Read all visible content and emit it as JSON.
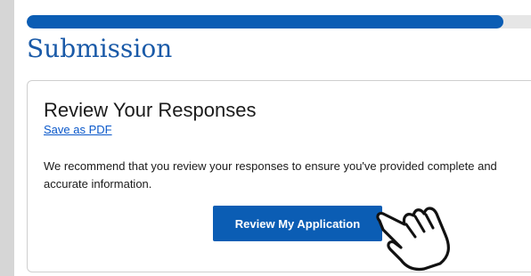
{
  "progress": {
    "fraction": 0.945,
    "fill_color": "#0b5db4",
    "track_color": "#e6e6e6"
  },
  "page_title": "Submission",
  "card": {
    "heading": "Review Your Responses",
    "save_link": "Save as PDF",
    "body": "We recommend that you review your responses to ensure you've provided complete and accurate information.",
    "button_label": "Review My Application"
  },
  "colors": {
    "accent": "#0b5db4",
    "title": "#1a5aa8",
    "link": "#0a58ca"
  },
  "cursor_icon": "hand-pointer-icon"
}
